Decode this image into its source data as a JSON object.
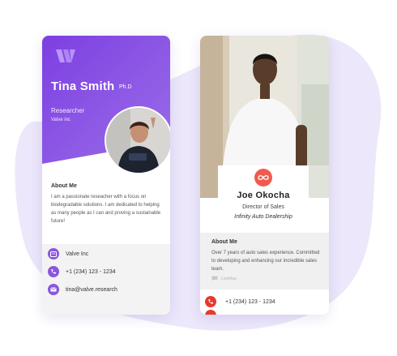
{
  "colors": {
    "purple": "#7a3fe0",
    "purple_light": "#9a6ee8",
    "blob": "#ece7fb",
    "coral": "#ef5b4f",
    "red": "#e8392f"
  },
  "card1": {
    "logo_icon": "brand-logo-icon",
    "name": "Tina Smith",
    "credential": "Ph.D",
    "title": "Researcher",
    "company": "Valve inc",
    "about_heading": "About Me",
    "about_text": "I am a passionate reseacher with a focus on biodegradable solutions. I am dedicated to helping as many people as I can and proving a sustainable future!",
    "contacts": [
      {
        "icon": "company-card-icon",
        "text": "Valve Inc"
      },
      {
        "icon": "phone-icon",
        "text": "+1 (234) 123 - 1234"
      },
      {
        "icon": "email-icon",
        "text": "tina@valve.research"
      }
    ]
  },
  "card2": {
    "badge_icon": "infinity-icon",
    "name": "Joe Okocha",
    "title": "Director of Sales",
    "company": "Infinity Auto Dealership",
    "about_heading": "About Me",
    "about_text": "Over 7 years of auto sales experience. Committed to developing and enhancing our incredible sales team.",
    "extra_label": "LiveMap",
    "contacts": [
      {
        "icon": "phone-icon",
        "text": "+1 (234) 123 - 1234"
      }
    ]
  }
}
